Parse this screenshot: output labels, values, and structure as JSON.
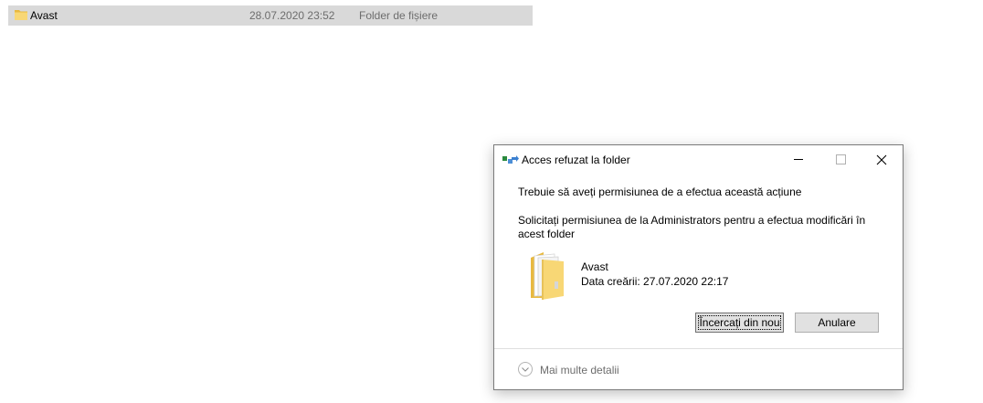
{
  "explorer": {
    "row": {
      "name": "Avast",
      "date_modified": "28.07.2020 23:52",
      "type": "Folder de fișiere",
      "icon": "folder-icon",
      "selected_color": "#d9d9d9"
    }
  },
  "dialog": {
    "title": "Acces refuzat la folder",
    "title_icon": "folder-access-icon",
    "window_controls": {
      "minimize": "minimize-icon",
      "maximize": "maximize-icon",
      "close": "close-icon"
    },
    "message_primary": "Trebuie să aveți permisiunea de a efectua această acțiune",
    "message_secondary": "Solicitați permisiunea de la Administrators pentru a efectua modificări în acest folder",
    "item": {
      "icon": "folder-large-icon",
      "name": "Avast",
      "created": "Data creării: 27.07.2020 22:17"
    },
    "buttons": {
      "retry": "Încercați din nou",
      "cancel": "Anulare"
    },
    "details": {
      "icon": "chevron-down-icon",
      "label": "Mai multe detalii"
    }
  }
}
